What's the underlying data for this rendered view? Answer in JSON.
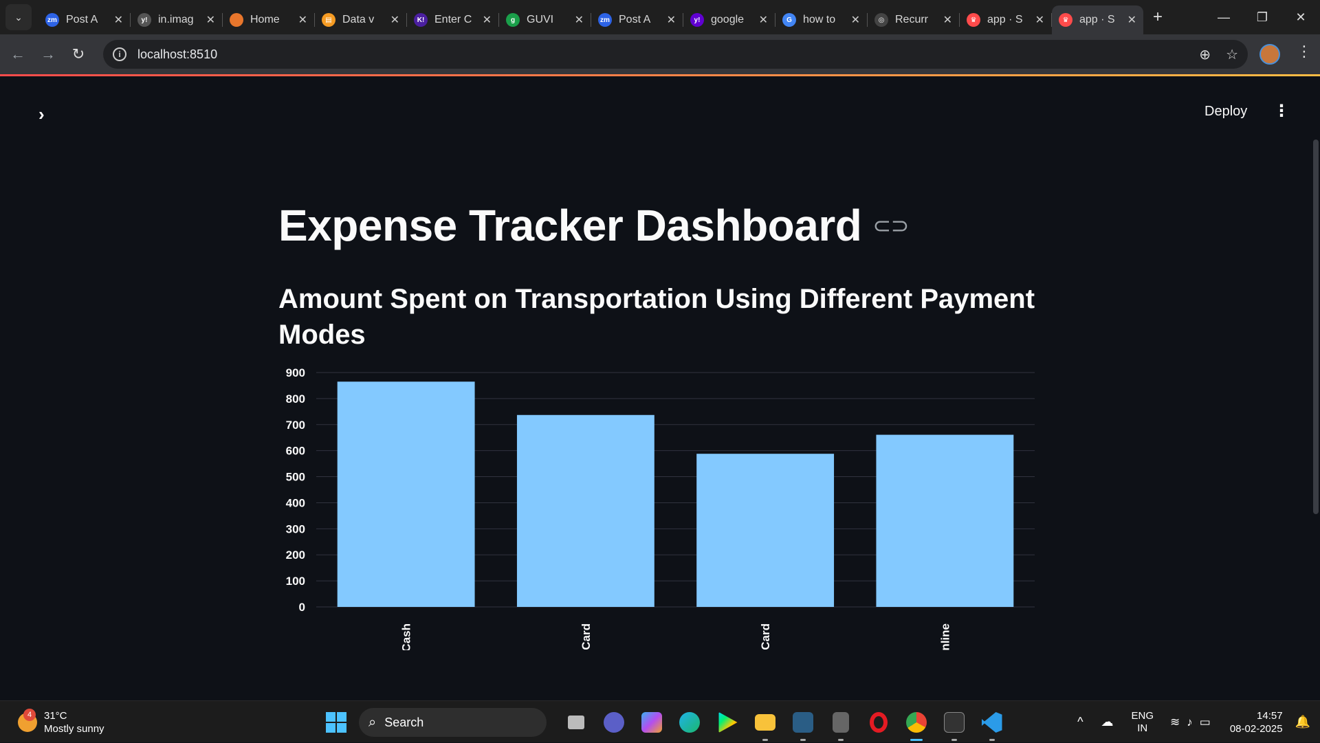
{
  "browser": {
    "tabs": [
      {
        "label": "Post A",
        "icon": "zm-icon",
        "color": "#2d63e6"
      },
      {
        "label": "in.imag",
        "icon": "y-icon",
        "color": "#555555"
      },
      {
        "label": "Home",
        "icon": "c-icon",
        "color": "#e8762c"
      },
      {
        "label": "Data v",
        "icon": "book-icon",
        "color": "#f59b23"
      },
      {
        "label": "Enter C",
        "icon": "k-icon",
        "color": "#4b1fa0"
      },
      {
        "label": "GUVI",
        "icon": "g-icon",
        "color": "#1a9f4a"
      },
      {
        "label": "Post A",
        "icon": "zm-icon",
        "color": "#2d63e6"
      },
      {
        "label": "google",
        "icon": "y-icon",
        "color": "#6001d2"
      },
      {
        "label": "how to",
        "icon": "google-icon",
        "color": "#4285f4"
      },
      {
        "label": "Recurr",
        "icon": "openai-icon",
        "color": "#444444"
      },
      {
        "label": "app · S",
        "icon": "streamlit-icon",
        "color": "#ff4b4b"
      },
      {
        "label": "app · S",
        "icon": "streamlit-icon",
        "color": "#ff4b4b"
      }
    ],
    "url": "localhost:8510"
  },
  "app": {
    "deploy_label": "Deploy",
    "title": "Expense Tracker Dashboard",
    "subtitle": "Amount Spent on Transportation Using Different Payment Modes"
  },
  "chart_data": {
    "type": "bar",
    "categories": [
      "Cash",
      "Debit Card",
      "Credit Card",
      "Online"
    ],
    "visible_tick_labels": [
      "Cash",
      "it Card",
      "it Card",
      "Online"
    ],
    "values": [
      865,
      737,
      588,
      661
    ],
    "ylim": [
      0,
      900
    ],
    "yticks": [
      0,
      100,
      200,
      300,
      400,
      500,
      600,
      700,
      800,
      900
    ],
    "bar_color": "#83c9ff",
    "grid": true
  },
  "taskbar": {
    "weather_temp": "31°C",
    "weather_desc": "Mostly sunny",
    "weather_badge": "4",
    "search_label": "Search",
    "lang_top": "ENG",
    "lang_bottom": "IN",
    "time": "14:57",
    "date": "08-02-2025"
  }
}
